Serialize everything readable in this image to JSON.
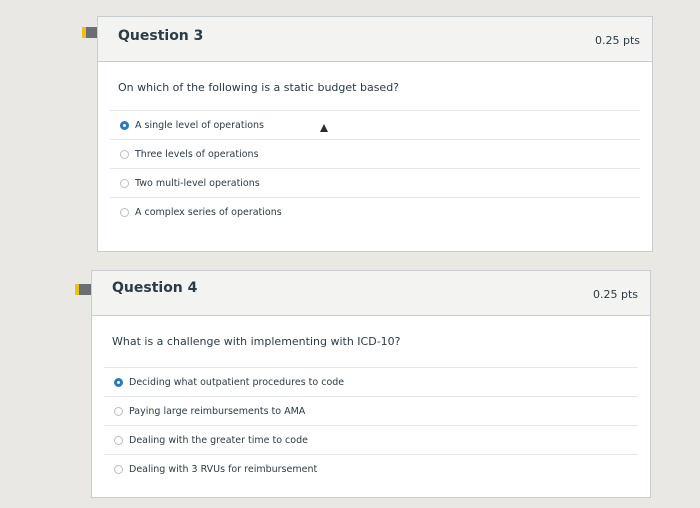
{
  "questions": [
    {
      "title": "Question 3",
      "points": "0.25 pts",
      "prompt": "On which of the following is a static budget based?",
      "answers": [
        {
          "label": "A single level of operations",
          "selected": true
        },
        {
          "label": "Three levels of operations",
          "selected": false
        },
        {
          "label": "Two multi-level operations",
          "selected": false
        },
        {
          "label": "A complex series of operations",
          "selected": false
        }
      ]
    },
    {
      "title": "Question 4",
      "points": "0.25 pts",
      "prompt": "What is a challenge with implementing with ICD-10?",
      "answers": [
        {
          "label": "Deciding what outpatient procedures to code",
          "selected": true
        },
        {
          "label": "Paying large reimbursements to AMA",
          "selected": false
        },
        {
          "label": "Dealing with the greater time to code",
          "selected": false
        },
        {
          "label": "Dealing with 3 RVUs for reimbursement",
          "selected": false
        }
      ]
    }
  ],
  "colors": {
    "flag": "#6b6f73",
    "flag_stripe": "#e8c020",
    "radio_selected": "#2b7abc"
  },
  "icons": {
    "flag": "flag-icon",
    "cursor": "mouse-cursor-icon"
  }
}
